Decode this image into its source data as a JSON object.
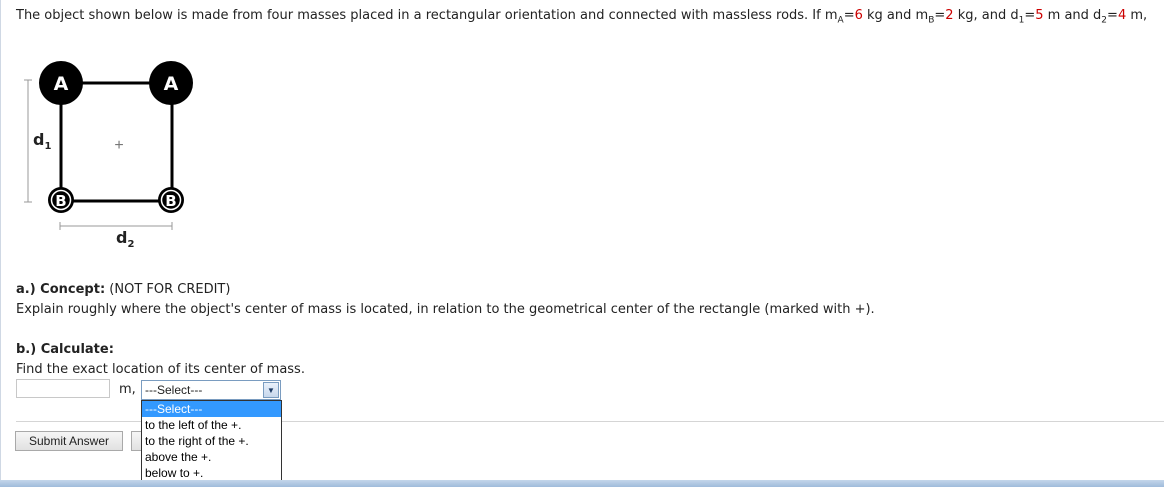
{
  "problem": {
    "intro": "The object shown below is made from four masses placed in a rectangular orientation and connected with massless rods. If m",
    "mA_sub": "A",
    "mA_eq": "=",
    "mA_value": "6",
    "mid1": " kg and m",
    "mB_sub": "B",
    "mB_eq": "=",
    "mB_value": "2",
    "mid2": " kg, and d",
    "d1_sub": "1",
    "d1_eq": "=",
    "d1_value": "5",
    "mid3": " m and d",
    "d2_sub": "2",
    "d2_eq": "=",
    "d2_value": "4",
    "tail": " m,"
  },
  "diagram": {
    "mass_top_left": "A",
    "mass_top_right": "A",
    "mass_bottom_left": "B",
    "mass_bottom_right": "B",
    "center_marker": "+",
    "d1_label": "d",
    "d1_sub": "1",
    "d2_label": "d",
    "d2_sub": "2"
  },
  "part_a": {
    "heading": "a.) Concept:",
    "note": " (NOT FOR CREDIT)",
    "text": "Explain roughly where the object's center of mass is located, in relation to the geometrical center of the rectangle (marked with +)."
  },
  "part_b": {
    "heading": "b.) Calculate:",
    "text": "Find the exact location of its center of mass.",
    "input_value": "",
    "unit": "m,",
    "select_value": "---Select---",
    "options": [
      "---Select---",
      "to the left of the +.",
      "to the right of the +.",
      "above the +.",
      "below to +."
    ]
  },
  "submit_label": "Submit Answer",
  "colors": {
    "highlight": "#cc0000",
    "selected_option": "#3399ff",
    "mass_fill": "#000000"
  },
  "icons": {
    "dropdown": "chevron-down-icon"
  }
}
